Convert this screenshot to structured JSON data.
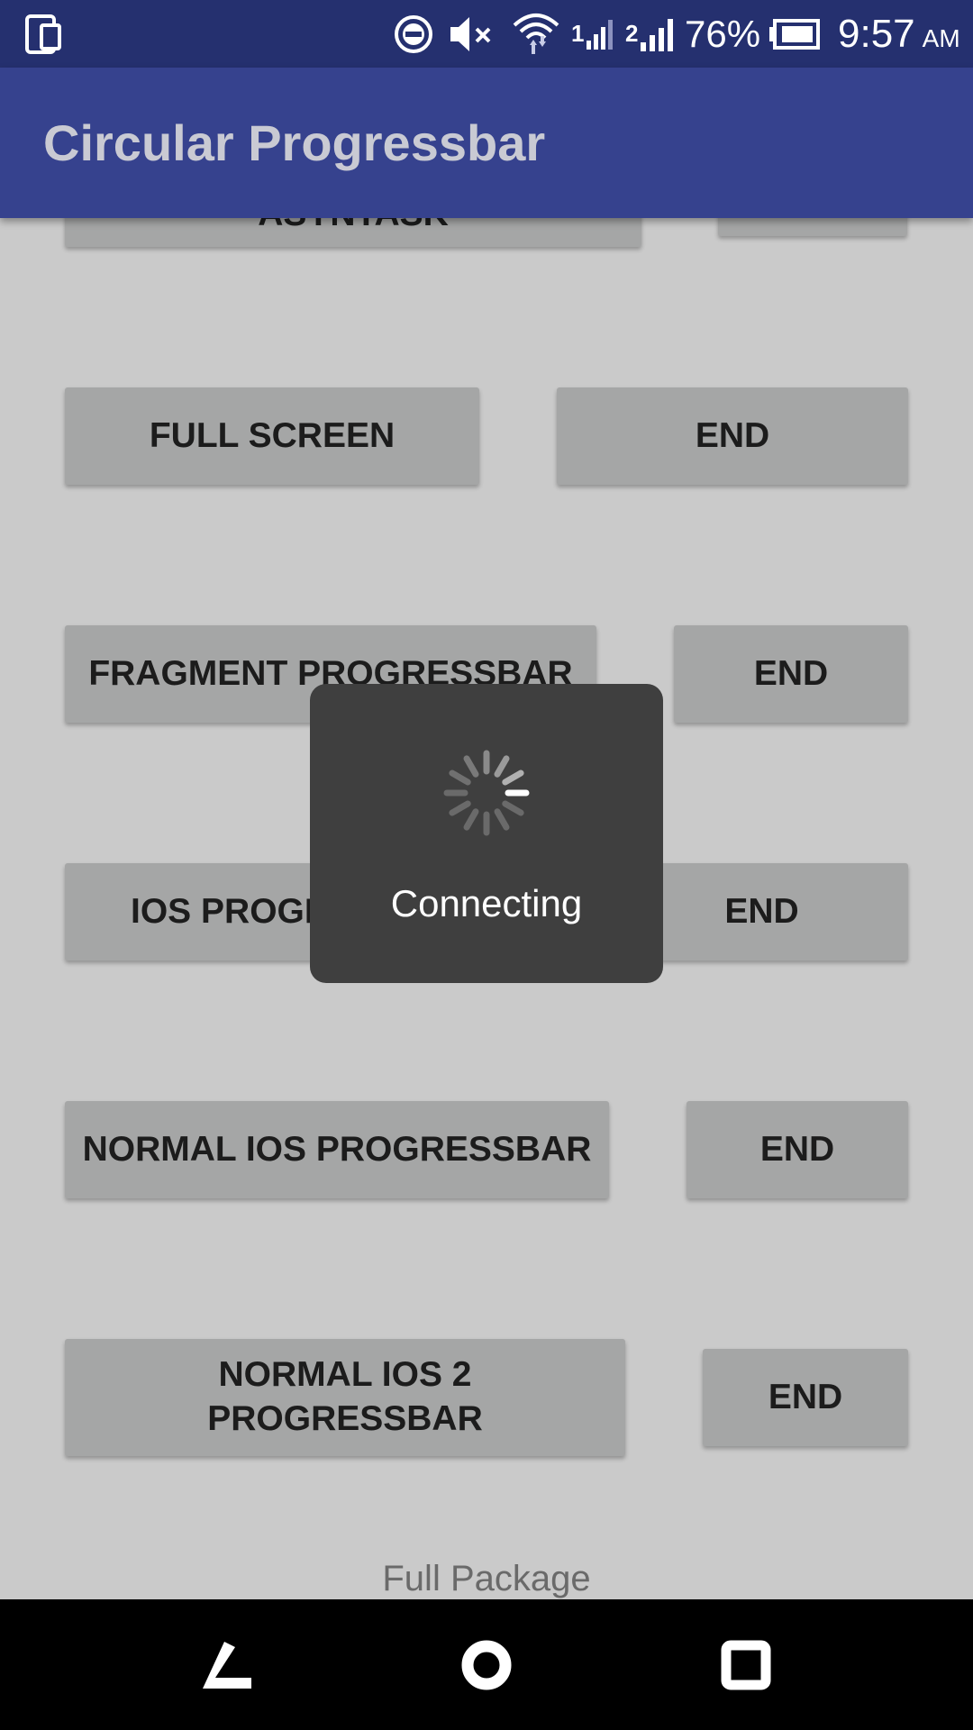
{
  "status_bar": {
    "battery": "76%",
    "time": "9:57",
    "ampm": "AM",
    "bg_color": "#25306f",
    "icons": [
      "phone-device-icon",
      "do-not-disturb-icon",
      "volume-muted-icon",
      "wifi-icon",
      "signal-sim1-icon",
      "signal-sim2-icon",
      "battery-icon"
    ],
    "sim1_label": "1",
    "sim2_label": "2"
  },
  "app_bar": {
    "title": "Circular Progressbar",
    "bg_color": "#36428e"
  },
  "buttons": {
    "asynctask": "ASYNTASK",
    "full_screen": "FULL SCREEN",
    "fragment": "FRAGMENT PROGRESSBAR",
    "ios": "IOS PROGRESSBAR",
    "normal_ios": "NORMAL IOS PROGRESSBAR",
    "normal_ios2": "NORMAL IOS 2 PROGRESSBAR",
    "end": "END"
  },
  "footer_text": "Full Package",
  "dialog": {
    "message": "Connecting",
    "icon": "loading-spinner-icon"
  },
  "nav_bar": {
    "icons": [
      "back-icon",
      "home-icon",
      "recents-icon"
    ]
  }
}
